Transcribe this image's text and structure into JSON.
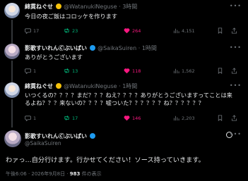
{
  "replies": [
    {
      "name": "綿貫ねぐせ",
      "handle": "@WatanukiNeguse",
      "time": "3時間",
      "text": "今日の夜ご飯はコロッケを作ります",
      "replies": "17",
      "retweets": "23",
      "likes": "264",
      "views": "4,151"
    },
    {
      "name": "影歌すいれん🄫ぶいぱい",
      "handle": "@SaikaSuiren",
      "time": "1時間",
      "text": "ありがとうございます",
      "replies": "1",
      "retweets": "13",
      "likes": "118",
      "views": "1,562"
    },
    {
      "name": "綿貫ねぐせ",
      "handle": "@WatanukiNeguse",
      "time": "1時間",
      "text": "いつくるの？？？？まだ？？？ねえ？？？？ありがとうございますってことは来るよね？？？来ないの？？？？嘘ついた？？？？？？ね？？？？？？",
      "replies": "1",
      "retweets": "17",
      "likes": "146",
      "views": "2,203"
    }
  ],
  "name_suffix_1": "ぶいぱい",
  "main": {
    "name": "影歌すいれん🄫ぶいぱい",
    "handle": "@SaikaSuiren",
    "text": "わァっ…自分行けます。行かせてください！ソース持っていきます。",
    "timestamp": "午後6:06 · 2026年9月8日 · ",
    "views_count": "983",
    "views_label": " 件の表示"
  },
  "colors": {
    "retweet": "#00ba7c",
    "like": "#f91880",
    "verified": "#f5c20b"
  }
}
